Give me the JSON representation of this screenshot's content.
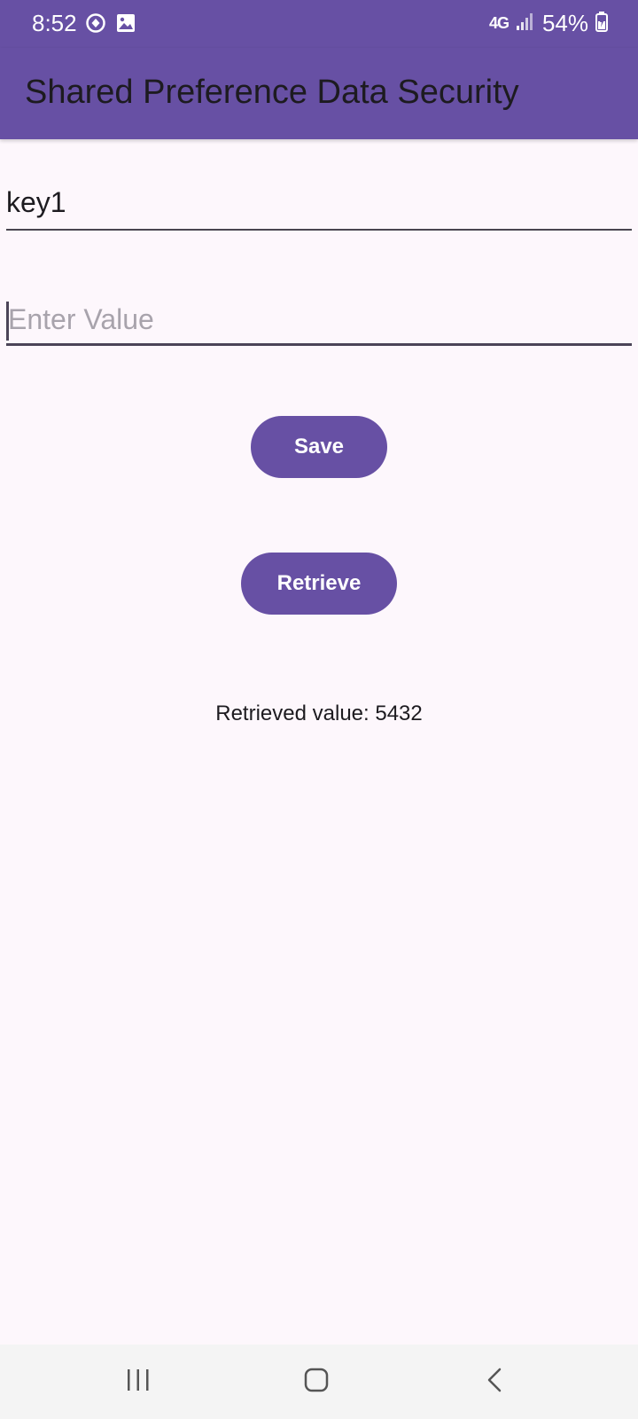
{
  "status_bar": {
    "time": "8:52",
    "network": "4G",
    "battery": "54%",
    "icons": [
      "sync-icon",
      "image-icon",
      "signal-icon",
      "battery-icon"
    ]
  },
  "app_bar": {
    "title": "Shared Preference Data Security",
    "background": "#6750A4"
  },
  "form": {
    "key_value": "key1",
    "value_placeholder": "Enter Value",
    "value_input_focused": true
  },
  "buttons": {
    "save_label": "Save",
    "retrieve_label": "Retrieve",
    "color": "#6750A4"
  },
  "result": {
    "text": "Retrieved value: 5432"
  },
  "nav_bar": {
    "icons": [
      "recents-icon",
      "home-icon",
      "back-icon"
    ]
  }
}
